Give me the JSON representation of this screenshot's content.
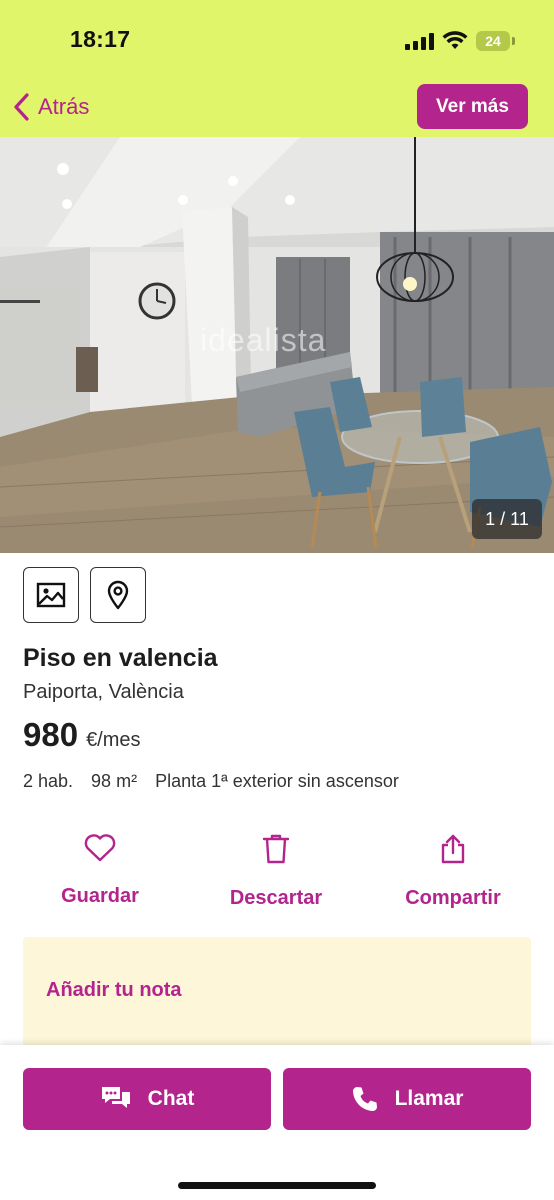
{
  "status_bar": {
    "time": "18:17",
    "battery": "24"
  },
  "nav": {
    "back_label": "Atrás",
    "more_label": "Ver más"
  },
  "photo": {
    "watermark": "idealista",
    "counter": "1 / 11"
  },
  "media_buttons": [
    {
      "icon": "image-icon"
    },
    {
      "icon": "map-pin-icon"
    }
  ],
  "listing": {
    "title": "Piso en valencia",
    "location": "Paiporta, València",
    "price": "980",
    "price_unit": "€/mes",
    "features": [
      "2 hab.",
      "98 m²",
      "Planta 1ª exterior sin ascensor"
    ]
  },
  "actions": [
    {
      "label": "Guardar",
      "icon": "heart-icon"
    },
    {
      "label": "Descartar",
      "icon": "trash-icon"
    },
    {
      "label": "Compartir",
      "icon": "share-icon"
    }
  ],
  "note": {
    "label": "Añadir tu nota"
  },
  "bottom_bar": {
    "chat_label": "Chat",
    "call_label": "Llamar"
  },
  "colors": {
    "header": "#e1f56a",
    "accent": "#b3248c",
    "note_bg": "#fdf6d8"
  }
}
